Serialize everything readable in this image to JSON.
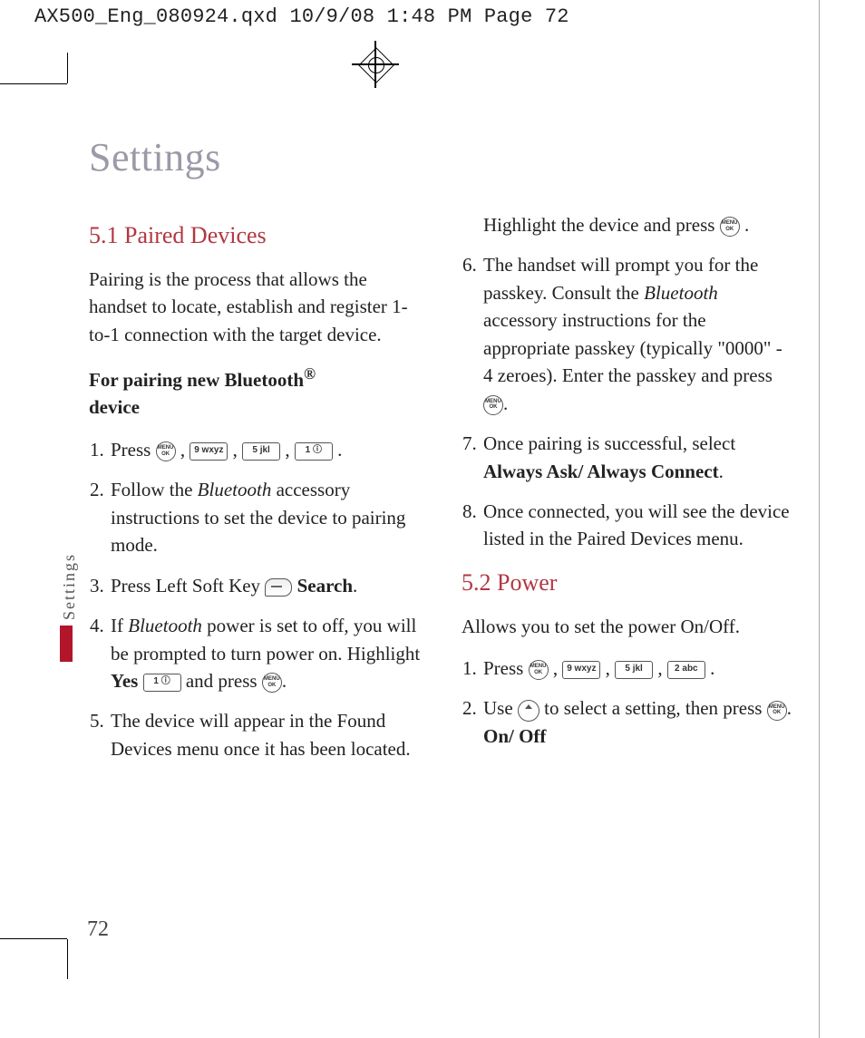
{
  "printHeader": "AX500_Eng_080924.qxd  10/9/08  1:48 PM  Page 72",
  "pageTitle": "Settings",
  "sideLabel": "Settings",
  "pageNumber": "72",
  "sec1": {
    "heading": "5.1 Paired Devices",
    "intro": "Pairing is the process that allows the handset to locate, establish and register 1-to-1 connection with the target device.",
    "subBold1": "For pairing new Bluetooth",
    "subBold1sup": "®",
    "subBold2": "device",
    "step1": "Press ",
    "step2a": "Follow the ",
    "step2i": "Bluetooth",
    "step2b": " accessory instructions to set the device to pairing mode.",
    "step3a": "Press Left Soft Key ",
    "step3b": "Search",
    "step3c": ".",
    "step4a": "If ",
    "step4i": "Bluetooth",
    "step4b": " power is set to off, you will be prompted to turn power on. Highlight ",
    "step4c": "Yes",
    "step4d": " and press ",
    "step4e": ".",
    "step5": "The device will appear in the Found Devices menu once it has been located. Highlight the device and press ",
    "step6a": "The handset will prompt you for the passkey. Consult the ",
    "step6i": "Bluetooth",
    "step6b": " accessory instructions for the appropriate passkey (typically \"0000\" - 4 zeroes). Enter the passkey and press ",
    "step6c": ".",
    "step7a": "Once pairing is successful, select ",
    "step7b": "Always Ask/ Always Connect",
    "step7c": ".",
    "step8": "Once connected, you will see the device listed in the Paired Devices menu."
  },
  "sec2": {
    "heading": "5.2 Power",
    "intro": "Allows you to set the power On/Off.",
    "step1": "Press ",
    "step2a": "Use ",
    "step2b": " to select a setting, then press ",
    "step2c": ".",
    "opts": "On/ Off"
  },
  "keys": {
    "ok": "MENU\nOK",
    "k9": "9 wxyz",
    "k5": "5 jkl",
    "k1": "1 ⓘ",
    "k2": "2 abc"
  }
}
